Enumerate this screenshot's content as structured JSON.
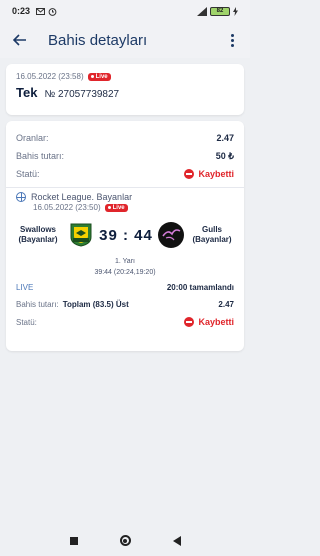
{
  "status_bar": {
    "time": "0:23",
    "battery": "82"
  },
  "header": {
    "title": "Bahis detayları"
  },
  "bet": {
    "date": "16.05.2022 (23:58)",
    "live_label": "Live",
    "type": "Tek",
    "number": "№ 27057739827"
  },
  "summary": {
    "odds_label": "Oranlar:",
    "odds_value": "2.47",
    "stake_label": "Bahis tutarı:",
    "stake_value": "50 ₺",
    "status_label": "Statü:",
    "status_value": "Kaybetti"
  },
  "event": {
    "league": "Rocket League. Bayanlar",
    "date": "16.05.2022 (23:50)",
    "live_label": "Live",
    "home_team": "Swallows (Bayanlar)",
    "away_team": "Gulls (Bayanlar)",
    "score": "39 : 44",
    "period": "1. Yarı",
    "period_detail": "39:44 (20:24,19:20)",
    "live_text": "LIVE",
    "finished_text": "20:00 tamamlandı",
    "stake_label": "Bahis tutarı:",
    "selection": "Toplam (83.5) Üst",
    "odd": "2.47",
    "status_label": "Statü:",
    "status_value": "Kaybetti"
  },
  "colors": {
    "accent": "#1d3a66",
    "lost": "#e0252b",
    "live": "#e0252b"
  }
}
